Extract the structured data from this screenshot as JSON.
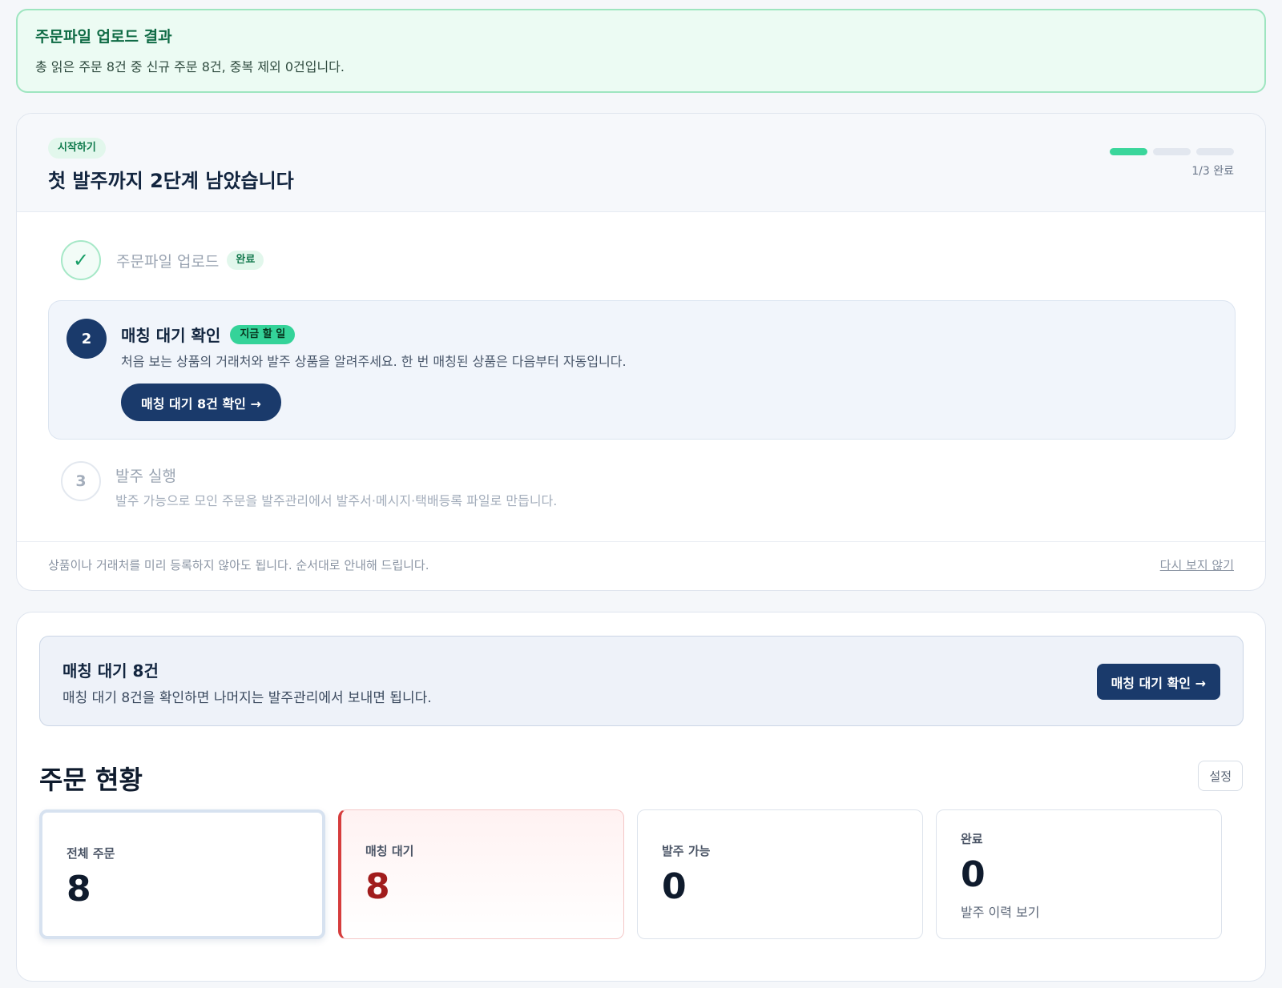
{
  "upload_result": {
    "title": "주문파일 업로드 결과",
    "message": "총 읽은 주문 8건 중 신규 주문 8건, 중복 제외 0건입니다."
  },
  "onboarding": {
    "badge": "시작하기",
    "title": "첫 발주까지 2단계 남았습니다",
    "progress": {
      "completed": 1,
      "total": 3,
      "label": "1/3 완료"
    },
    "steps": [
      {
        "indicator": "✓",
        "title": "주문파일 업로드",
        "badge": "완료",
        "status": "done"
      },
      {
        "indicator": "2",
        "title": "매칭 대기 확인",
        "badge": "지금 할 일",
        "description": "처음 보는 상품의 거래처와 발주 상품을 알려주세요. 한 번 매칭된 상품은 다음부터 자동입니다.",
        "button": "매칭 대기 8건 확인 →",
        "status": "current"
      },
      {
        "indicator": "3",
        "title": "발주 실행",
        "description": "발주 가능으로 모인 주문을 발주관리에서 발주서·메시지·택배등록 파일로 만듭니다.",
        "status": "pending"
      }
    ],
    "footer_hint": "상품이나 거래처를 미리 등록하지 않아도 됩니다. 순서대로 안내해 드립니다.",
    "dismiss_link": "다시 보지 않기"
  },
  "pending_alert": {
    "title": "매칭 대기 8건",
    "message": "매칭 대기 8건을 확인하면 나머지는 발주관리에서 보내면 됩니다.",
    "button": "매칭 대기 확인 →"
  },
  "order_status": {
    "title": "주문 현황",
    "settings_button": "설정",
    "cards": [
      {
        "label": "전체 주문",
        "value": "8"
      },
      {
        "label": "매칭 대기",
        "value": "8"
      },
      {
        "label": "발주 가능",
        "value": "0"
      },
      {
        "label": "완료",
        "value": "0",
        "link": "발주 이력 보기"
      }
    ]
  },
  "colors": {
    "primary": "#1a3a6b",
    "success": "#34d399",
    "danger": "#a11c1c",
    "banner_bg": "#ecfbf3"
  }
}
